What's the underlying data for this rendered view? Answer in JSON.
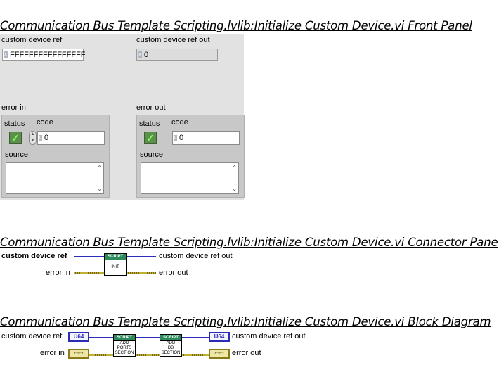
{
  "front_panel": {
    "heading": "Communication Bus Template Scripting.lvlib:Initialize Custom Device.vi Front Panel",
    "custom_device_ref": {
      "label": "custom device ref",
      "value": "FFFFFFFFFFFFFFFF",
      "radix": "x"
    },
    "custom_device_ref_out": {
      "label": "custom device ref out",
      "value": "0",
      "radix": "x"
    },
    "error_in": {
      "label": "error in",
      "status_label": "status",
      "code_label": "code",
      "code_value": "0",
      "code_radix": "d",
      "source_label": "source",
      "source_value": ""
    },
    "error_out": {
      "label": "error out",
      "status_label": "status",
      "code_label": "code",
      "code_value": "0",
      "code_radix": "d",
      "source_label": "source",
      "source_value": ""
    },
    "status_glyph": "✓"
  },
  "connector_pane": {
    "heading": "Communication Bus Template Scripting.lvlib:Initialize Custom Device.vi Connector Pane",
    "inputs": [
      "custom device ref",
      "error in"
    ],
    "outputs": [
      "custom device ref out",
      "error out"
    ],
    "vi_icon": {
      "band": "SCRIPT",
      "text": "INIT"
    }
  },
  "block_diagram": {
    "heading": "Communication Bus Template Scripting.lvlib:Initialize Custom Device.vi Block Diagram",
    "controls": [
      "custom device ref",
      "error in"
    ],
    "indicators": [
      "custom device ref out",
      "error out"
    ],
    "u64_tag": "U64",
    "error_tag": "▭▭",
    "subvis": [
      {
        "band": "SCRIPT",
        "line1": "ADD",
        "line2": "PORTS",
        "line3": "SECTION"
      },
      {
        "band": "SCRIPT",
        "line1": "ADD",
        "line2": "DB",
        "line3": "SECTION"
      }
    ]
  },
  "colors": {
    "panel": "#e2e2e2",
    "u64_wire": "#2d2cb8",
    "error_wire": "#c2b030",
    "script_band": "#2d8a5a"
  }
}
